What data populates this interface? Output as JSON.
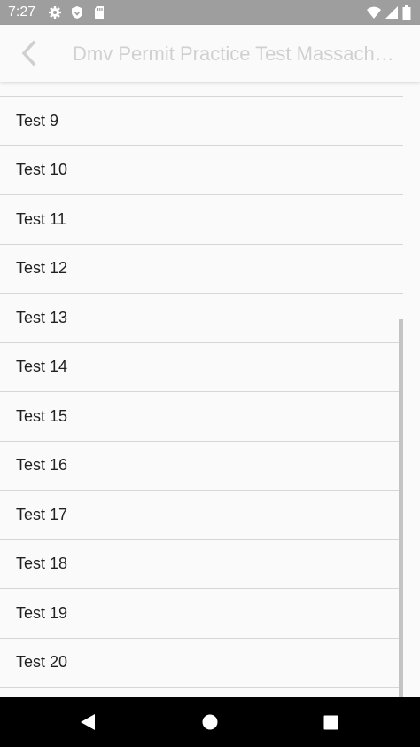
{
  "status_bar": {
    "time": "7:27",
    "left_icons": [
      "gear-icon",
      "shield-icon",
      "sd-card-icon"
    ],
    "right_icons": [
      "wifi-icon",
      "cell-signal-icon",
      "battery-icon"
    ]
  },
  "app_bar": {
    "back_icon": "chevron-left-icon",
    "title": "Dmv Permit Practice Test Massachusetts"
  },
  "list": {
    "items": [
      {
        "label": "Test 9"
      },
      {
        "label": "Test 10"
      },
      {
        "label": "Test 11"
      },
      {
        "label": "Test 12"
      },
      {
        "label": "Test 13"
      },
      {
        "label": "Test 14"
      },
      {
        "label": "Test 15"
      },
      {
        "label": "Test 16"
      },
      {
        "label": "Test 17"
      },
      {
        "label": "Test 18"
      },
      {
        "label": "Test 19"
      },
      {
        "label": "Test 20"
      }
    ]
  },
  "nav_bar": {
    "icons": [
      "back-triangle-icon",
      "home-circle-icon",
      "recents-square-icon"
    ]
  },
  "colors": {
    "status_bar": "#9e9e9e",
    "background": "#fafafa",
    "title_text": "#d0d0d0",
    "item_text": "#212121",
    "divider": "#d6d6d6",
    "nav_bar": "#000000"
  }
}
